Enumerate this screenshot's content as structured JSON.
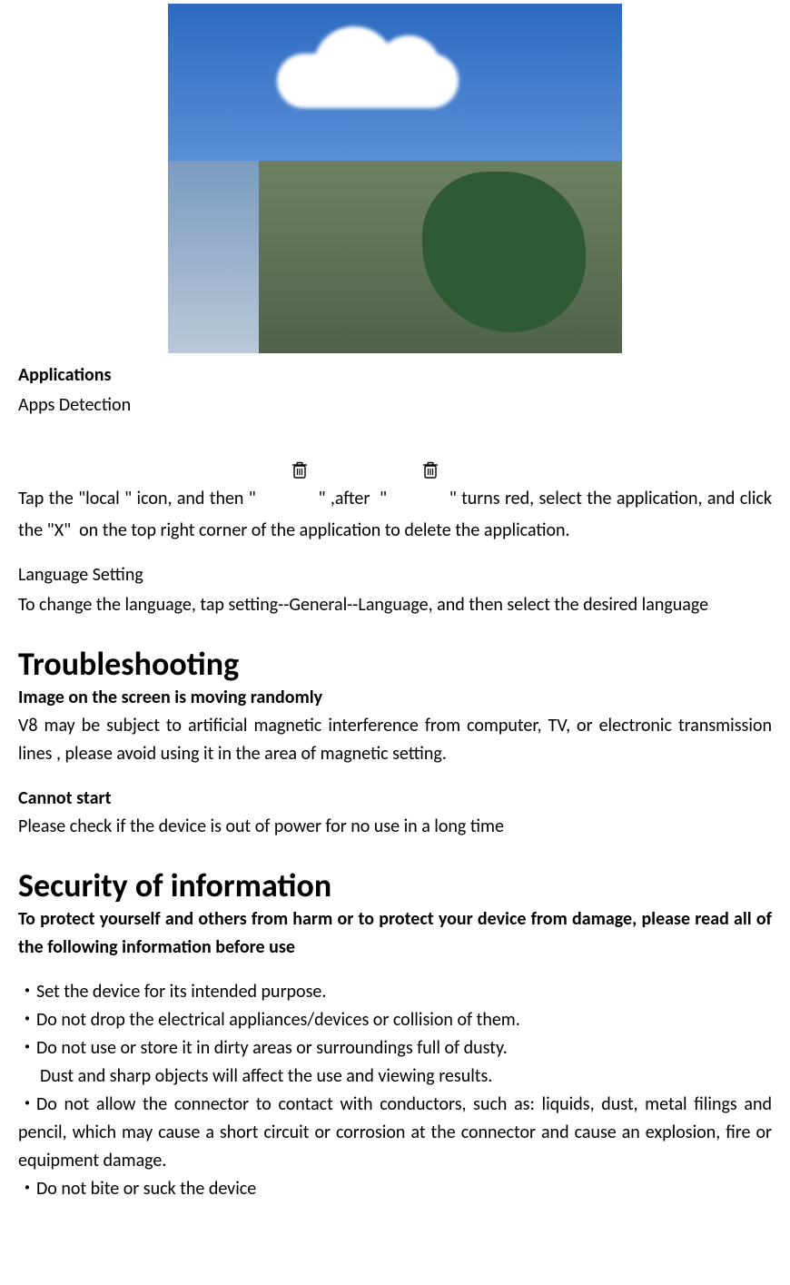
{
  "sections": {
    "applications": {
      "heading": "Applications",
      "apps_detection_label": "Apps Detection",
      "detect_para": {
        "p1": "Tap the \"local \" icon, and then \" ",
        "p2": " \" ,after  \" ",
        "p3": " \" turns red, select the application, and click the \"X\"  on the top right corner of the application to delete the application."
      },
      "lang_heading": "Language Setting",
      "lang_body": "To change the language, tap setting--General--Language, and then select the desired language"
    },
    "troubleshooting": {
      "heading": "Troubleshooting",
      "item1_title": "Image on the screen is moving randomly",
      "item1_body": "V8 may be subject to artificial magnetic interference from computer, TV, or electronic transmission lines , please avoid using it in the area of magnetic setting.",
      "item2_title": "Cannot start",
      "item2_body": "Please check if the device is out of power for no use in a long time"
    },
    "security": {
      "heading": "Security of information",
      "intro": "To protect yourself and others from harm or to protect your device from damage, please read all of the following information before use",
      "bullets": {
        "b1": "Set the device for its intended purpose.",
        "b2": "Do not drop the electrical appliances/devices or collision of them.",
        "b3": "Do not use or store it in dirty areas or surroundings full of dusty.",
        "b3_sub": "Dust and sharp objects will affect the use and viewing results.",
        "b4": "Do not allow the connector to contact with conductors, such as: liquids, dust, metal filings and pencil, which may cause a short circuit or corrosion at the connector and cause an explosion, fire or equipment damage.",
        "b5": "Do not bite or suck the device"
      }
    }
  },
  "glyphs": {
    "bullet_dot": "・"
  }
}
